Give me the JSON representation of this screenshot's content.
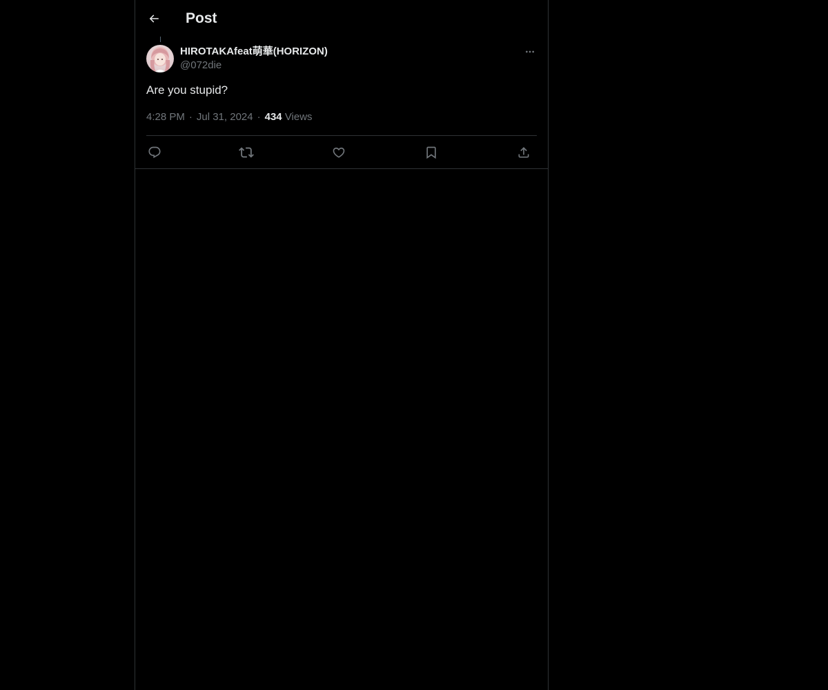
{
  "header": {
    "title": "Post",
    "back_icon": "arrow-left-icon"
  },
  "post": {
    "author": {
      "name": "HIROTAKAfeat萌華(HORIZON)",
      "handle": "@072die"
    },
    "text": "Are you stupid?",
    "time": "4:28 PM",
    "date": "Jul 31, 2024",
    "separator": "·",
    "views_count": "434",
    "views_label": "Views",
    "more_icon": "more-horizontal-icon"
  },
  "actions": [
    {
      "name": "reply",
      "icon": "reply-icon"
    },
    {
      "name": "repost",
      "icon": "repost-icon"
    },
    {
      "name": "like",
      "icon": "heart-icon"
    },
    {
      "name": "bookmark",
      "icon": "bookmark-icon"
    },
    {
      "name": "share",
      "icon": "share-icon"
    }
  ],
  "colors": {
    "background": "#000000",
    "text_primary": "#e7e9ea",
    "text_secondary": "#71767b",
    "border": "#2f3336"
  }
}
